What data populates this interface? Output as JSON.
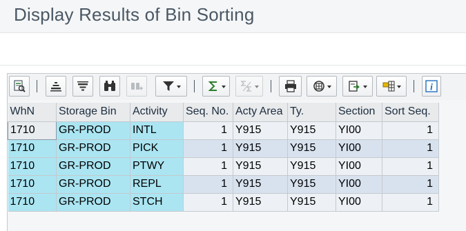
{
  "page": {
    "title": "Display Results of Bin Sorting"
  },
  "toolbar": {
    "buttons": [
      {
        "name": "details",
        "icon": "details-icon"
      },
      {
        "name": "sort-ascending",
        "icon": "sort-ascending-icon"
      },
      {
        "name": "sort-descending",
        "icon": "sort-descending-icon"
      },
      {
        "name": "find",
        "icon": "binoculars-icon"
      },
      {
        "name": "find-next",
        "icon": "find-next-icon",
        "disabled": true
      },
      {
        "name": "filter",
        "icon": "filter-icon",
        "dropdown": true
      },
      {
        "name": "total",
        "icon": "sigma-icon",
        "dropdown": true
      },
      {
        "name": "subtotal",
        "icon": "subtotal-icon",
        "dropdown": true,
        "disabled": true
      },
      {
        "name": "print-preview",
        "icon": "printer-icon"
      },
      {
        "name": "views",
        "icon": "views-icon",
        "dropdown": true
      },
      {
        "name": "export",
        "icon": "export-icon",
        "dropdown": true
      },
      {
        "name": "layout",
        "icon": "layout-icon",
        "dropdown": true
      },
      {
        "name": "info",
        "icon": "info-icon"
      }
    ]
  },
  "table": {
    "columns": [
      "WhN",
      "Storage Bin",
      "Activity",
      "Seq. No.",
      "Acty Area",
      "Ty.",
      "Section",
      "Sort Seq."
    ],
    "rows": [
      [
        "1710",
        "GR-PROD",
        "INTL",
        "1",
        "Y915",
        "Y915",
        "YI00",
        "1"
      ],
      [
        "1710",
        "GR-PROD",
        "PICK",
        "1",
        "Y915",
        "Y915",
        "YI00",
        "1"
      ],
      [
        "1710",
        "GR-PROD",
        "PTWY",
        "1",
        "Y915",
        "Y915",
        "YI00",
        "1"
      ],
      [
        "1710",
        "GR-PROD",
        "REPL",
        "1",
        "Y915",
        "Y915",
        "YI00",
        "1"
      ],
      [
        "1710",
        "GR-PROD",
        "STCH",
        "1",
        "Y915",
        "Y915",
        "YI00",
        "1"
      ]
    ]
  },
  "colors": {
    "key_column": "#abe5f2",
    "row_odd": "#edf1f5",
    "row_even": "#d8e2ef",
    "header": "#e8eaec"
  }
}
